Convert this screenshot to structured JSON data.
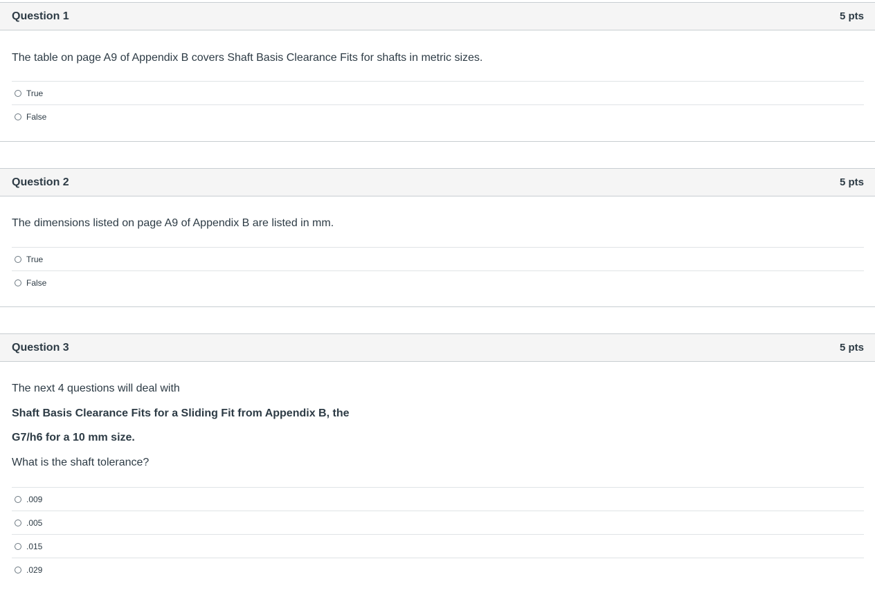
{
  "questions": [
    {
      "title": "Question 1",
      "points": "5 pts",
      "text": [
        "The table on page A9 of Appendix B covers Shaft Basis Clearance Fits for shafts in metric sizes."
      ],
      "answers": [
        "True",
        "False"
      ]
    },
    {
      "title": "Question 2",
      "points": "5 pts",
      "text": [
        "The dimensions listed on page A9 of Appendix B are listed in mm."
      ],
      "answers": [
        "True",
        "False"
      ]
    },
    {
      "title": "Question 3",
      "points": "5 pts",
      "text": [
        "The next 4 questions will deal with",
        "Shaft Basis Clearance Fits for a Sliding Fit from Appendix B, the",
        "G7/h6 for a 10 mm size.",
        "What is the shaft tolerance?"
      ],
      "answers": [
        ".009",
        ".005",
        ".015",
        ".029"
      ]
    }
  ]
}
